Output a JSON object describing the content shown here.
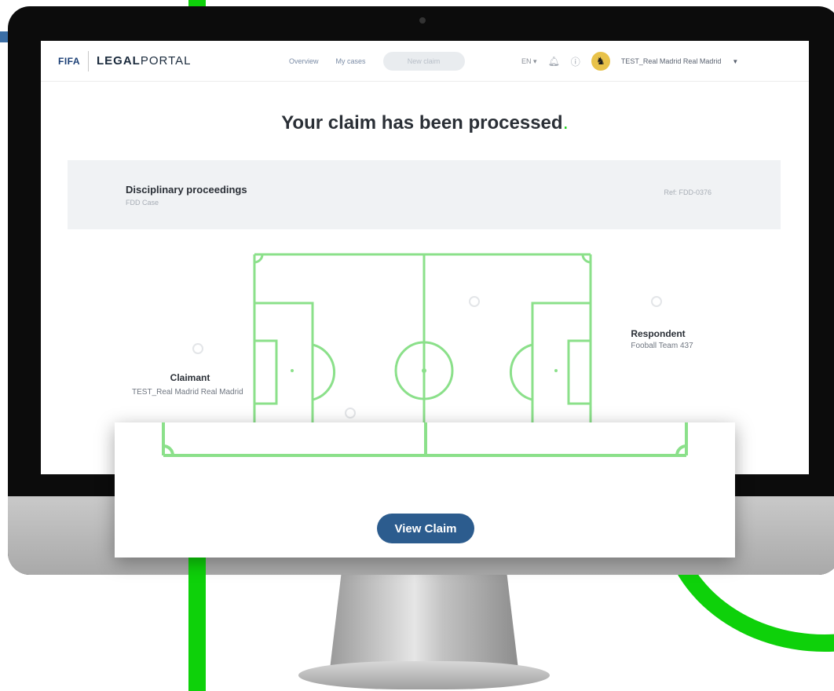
{
  "header": {
    "logo_fifa": "FIFA",
    "logo_legal": "LEGAL",
    "logo_portal": "PORTAL",
    "nav": {
      "overview": "Overview",
      "my_cases": "My cases",
      "new_claim": "New claim"
    },
    "language": "EN",
    "user": {
      "name": "TEST_Real Madrid Real Madrid"
    }
  },
  "headline": "Your claim has been processed",
  "case": {
    "title": "Disciplinary proceedings",
    "subtitle": "FDD Case",
    "reference": "Ref: FDD-0376"
  },
  "parties": {
    "claimant_label": "Claimant",
    "claimant_value": "TEST_Real Madrid Real Madrid",
    "respondent_label": "Respondent",
    "respondent_value": "Fooball Team 437"
  },
  "actions": {
    "view_claim": "View Claim"
  },
  "colors": {
    "accent_green": "#0ed10a",
    "pitch_line": "#8be08a",
    "button_blue": "#2c5c8e"
  },
  "icons": [
    "bell-icon",
    "help-icon",
    "user-placeholder-icon",
    "chevron-down-icon"
  ]
}
